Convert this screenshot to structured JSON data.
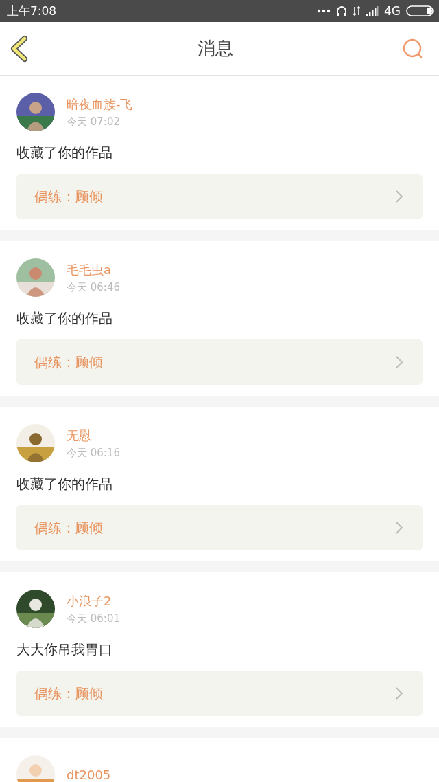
{
  "status_bar": {
    "time": "上午7:08",
    "network": "4G"
  },
  "header": {
    "title": "消息"
  },
  "messages": [
    {
      "name": "暗夜血族-飞",
      "time": "今天 07:02",
      "text": "收藏了你的作品",
      "link": "偶练：顾倾"
    },
    {
      "name": "毛毛虫a",
      "time": "今天 06:46",
      "text": "收藏了你的作品",
      "link": "偶练：顾倾"
    },
    {
      "name": "无慰",
      "time": "今天 06:16",
      "text": "收藏了你的作品",
      "link": "偶练：顾倾"
    },
    {
      "name": "小浪子2",
      "time": "今天 06:01",
      "text": "大大你吊我胃口",
      "link": "偶练：顾倾"
    },
    {
      "name": "dt2005"
    }
  ]
}
